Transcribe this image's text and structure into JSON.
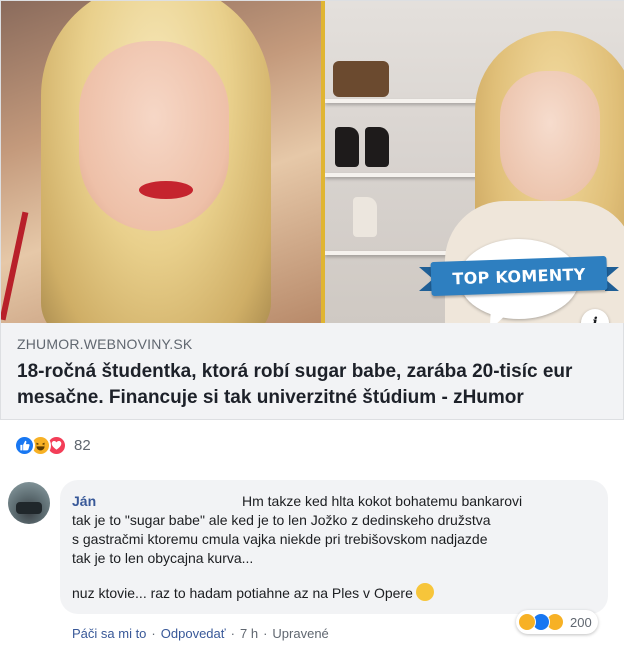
{
  "link_card": {
    "badge": "TOP KOMENTY",
    "info_icon_glyph": "i",
    "domain": "ZHUMOR.WEBNOVINY.SK",
    "title": "18-ročná študentka, ktorá robí sugar babe, zarába 20-tisíc eur mesačne. Financuje si tak univerzitné štúdium - zHumor"
  },
  "post_reactions": {
    "icons": [
      "like-icon",
      "haha-icon",
      "love-icon"
    ],
    "count": "82"
  },
  "comment": {
    "author": "Ján",
    "lines": [
      "Hm takze ked hlta kokot bohatemu bankarovi",
      "tak je to \"sugar babe\" ale ked je to len Jožko z dedinskeho družstva",
      "s gastračmi ktoremu cmula vajka niekde pri trebišovskom nadjazde",
      "tak je to len obycajna kurva..."
    ],
    "last_line": "nuz ktovie... raz to hadam potiahne az na Ples v Opere",
    "reactions": {
      "icons": [
        "haha-icon",
        "like-icon",
        "wow-icon"
      ],
      "count": "200"
    },
    "actions": {
      "like": "Páči sa mi to",
      "reply": "Odpovedať",
      "time": "7 h",
      "edited": "Upravené"
    }
  },
  "colors": {
    "link_blue": "#385898",
    "ribbon_blue": "#2e7fc0",
    "like_blue": "#1877f2",
    "love_red": "#f33e58",
    "haha_yellow": "#f7b125",
    "card_bg": "#f2f3f5"
  }
}
